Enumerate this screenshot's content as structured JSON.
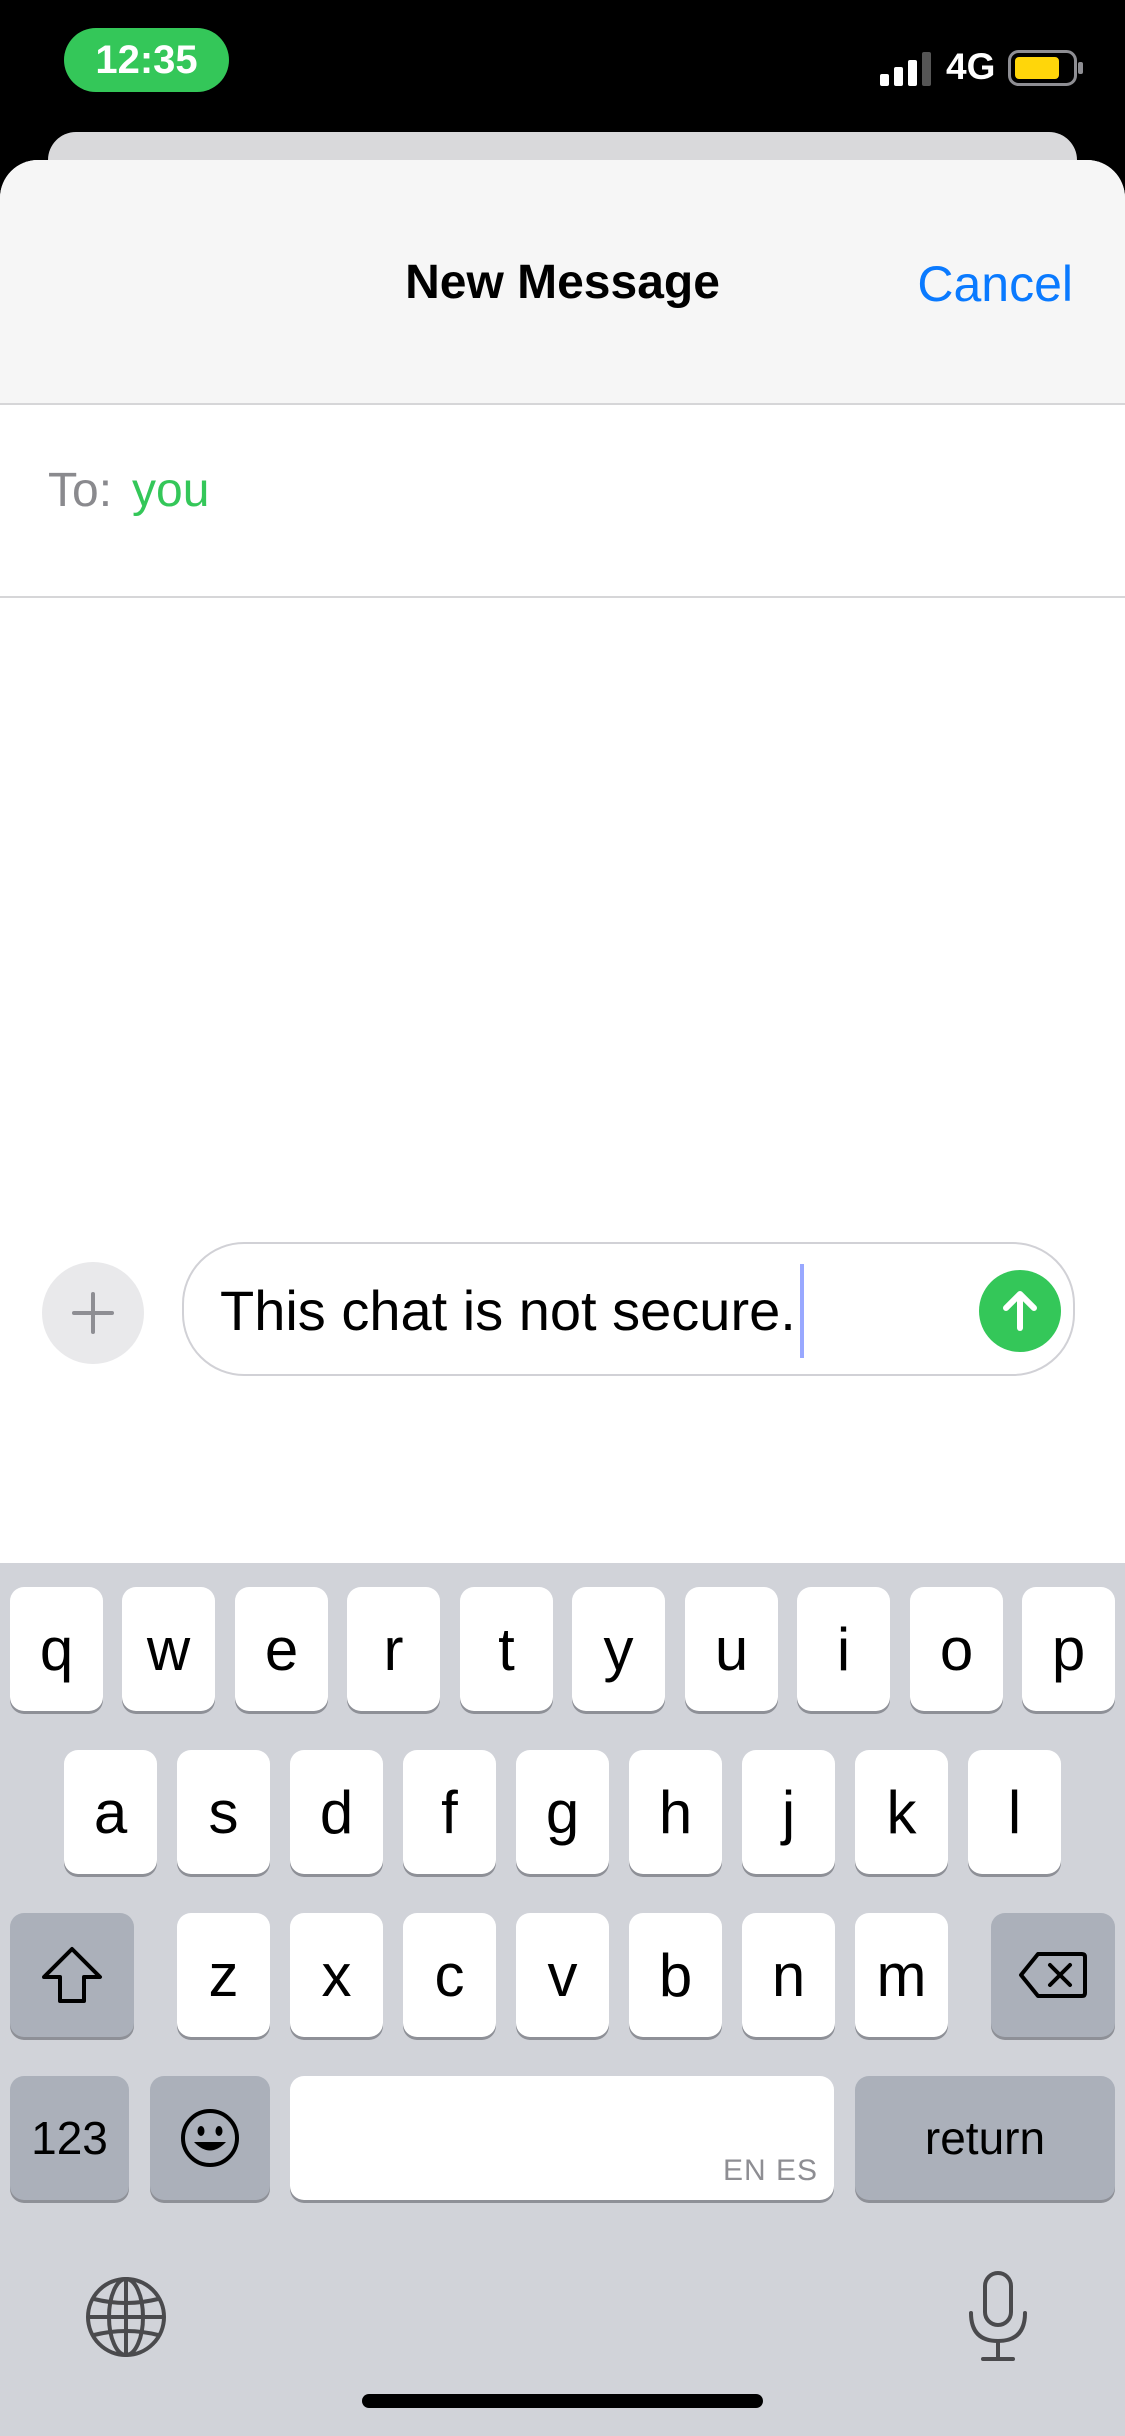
{
  "status_bar": {
    "time": "12:35",
    "network": "4G",
    "signal_icon": "cellular-signal-icon",
    "battery_icon": "battery-icon",
    "time_pill_color": "#34c759",
    "battery_color": "#ffd60a"
  },
  "header": {
    "title": "New Message",
    "cancel_label": "Cancel",
    "accent_color": "#0a7aff"
  },
  "recipient": {
    "label": "To:",
    "name": "you",
    "name_color": "#34c759"
  },
  "composer": {
    "add_icon": "plus-icon",
    "message_text": "This chat is not secure.",
    "send_icon": "arrow-up-icon"
  },
  "keyboard": {
    "row1": [
      "q",
      "w",
      "e",
      "r",
      "t",
      "y",
      "u",
      "i",
      "o",
      "p"
    ],
    "row2": [
      "a",
      "s",
      "d",
      "f",
      "g",
      "h",
      "j",
      "k",
      "l"
    ],
    "row3": [
      "z",
      "x",
      "c",
      "v",
      "b",
      "n",
      "m"
    ],
    "numbers_label": "123",
    "space_languages": "EN ES",
    "return_label": "return",
    "shift_icon": "shift-icon",
    "delete_icon": "delete-icon",
    "emoji_icon": "emoji-icon",
    "globe_icon": "globe-icon",
    "mic_icon": "microphone-icon"
  }
}
